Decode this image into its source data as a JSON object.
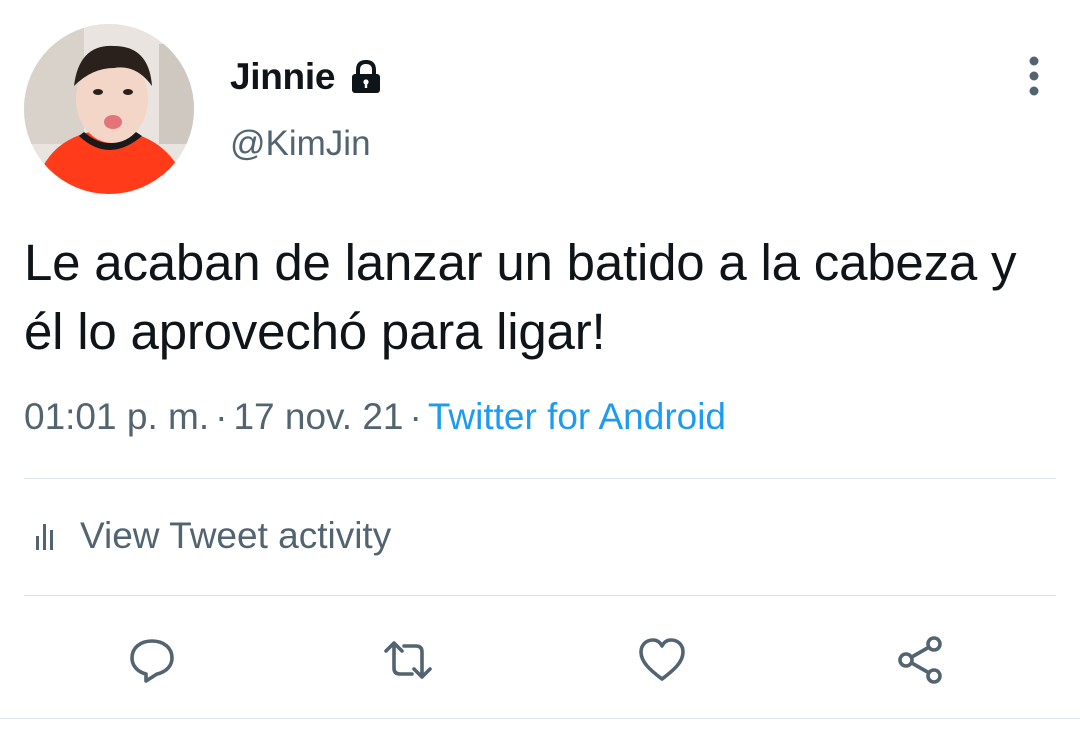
{
  "user": {
    "display_name": "Jinnie",
    "handle": "@KimJin",
    "protected_icon": "lock-icon",
    "avatar": "profile-photo"
  },
  "tweet": {
    "text": "Le acaban de lanzar un batido a la cabeza y él lo aprovechó para ligar!",
    "time": "01:01 p. m.",
    "date": "17 nov. 21",
    "separator": "·",
    "source": "Twitter for Android"
  },
  "activity": {
    "label": "View Tweet activity",
    "icon": "analytics-bars-icon"
  },
  "actions": {
    "reply_icon": "reply-icon",
    "retweet_icon": "retweet-icon",
    "like_icon": "heart-icon",
    "share_icon": "share-icon"
  },
  "colors": {
    "text_primary": "#0f1419",
    "text_secondary": "#536471",
    "link": "#1d9bf0",
    "divider": "#dde3e8",
    "background": "#ffffff"
  }
}
